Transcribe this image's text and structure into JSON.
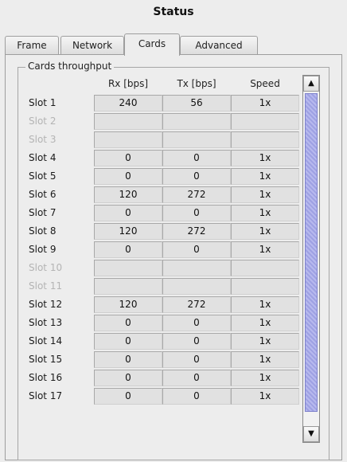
{
  "window": {
    "title": "Status"
  },
  "tabs": [
    {
      "label": "Frame",
      "active": false
    },
    {
      "label": "Network",
      "active": false
    },
    {
      "label": "Cards",
      "active": true
    },
    {
      "label": "Advanced",
      "active": false
    }
  ],
  "group": {
    "label": "Cards throughput"
  },
  "columns": {
    "rx": "Rx [bps]",
    "tx": "Tx [bps]",
    "speed": "Speed"
  },
  "rows": [
    {
      "slot": "Slot 1",
      "rx": "240",
      "tx": "56",
      "speed": "1x",
      "enabled": true
    },
    {
      "slot": "Slot 2",
      "rx": "",
      "tx": "",
      "speed": "",
      "enabled": false
    },
    {
      "slot": "Slot 3",
      "rx": "",
      "tx": "",
      "speed": "",
      "enabled": false
    },
    {
      "slot": "Slot 4",
      "rx": "0",
      "tx": "0",
      "speed": "1x",
      "enabled": true
    },
    {
      "slot": "Slot 5",
      "rx": "0",
      "tx": "0",
      "speed": "1x",
      "enabled": true
    },
    {
      "slot": "Slot 6",
      "rx": "120",
      "tx": "272",
      "speed": "1x",
      "enabled": true
    },
    {
      "slot": "Slot 7",
      "rx": "0",
      "tx": "0",
      "speed": "1x",
      "enabled": true
    },
    {
      "slot": "Slot 8",
      "rx": "120",
      "tx": "272",
      "speed": "1x",
      "enabled": true
    },
    {
      "slot": "Slot 9",
      "rx": "0",
      "tx": "0",
      "speed": "1x",
      "enabled": true
    },
    {
      "slot": "Slot 10",
      "rx": "",
      "tx": "",
      "speed": "",
      "enabled": false
    },
    {
      "slot": "Slot 11",
      "rx": "",
      "tx": "",
      "speed": "",
      "enabled": false
    },
    {
      "slot": "Slot 12",
      "rx": "120",
      "tx": "272",
      "speed": "1x",
      "enabled": true
    },
    {
      "slot": "Slot 13",
      "rx": "0",
      "tx": "0",
      "speed": "1x",
      "enabled": true
    },
    {
      "slot": "Slot 14",
      "rx": "0",
      "tx": "0",
      "speed": "1x",
      "enabled": true
    },
    {
      "slot": "Slot 15",
      "rx": "0",
      "tx": "0",
      "speed": "1x",
      "enabled": true
    },
    {
      "slot": "Slot 16",
      "rx": "0",
      "tx": "0",
      "speed": "1x",
      "enabled": true
    },
    {
      "slot": "Slot 17",
      "rx": "0",
      "tx": "0",
      "speed": "1x",
      "enabled": true
    }
  ],
  "scrollbar": {
    "up_icon": "arrow-up-icon",
    "down_icon": "arrow-down-icon",
    "thumb_color": "#a9abe9"
  }
}
